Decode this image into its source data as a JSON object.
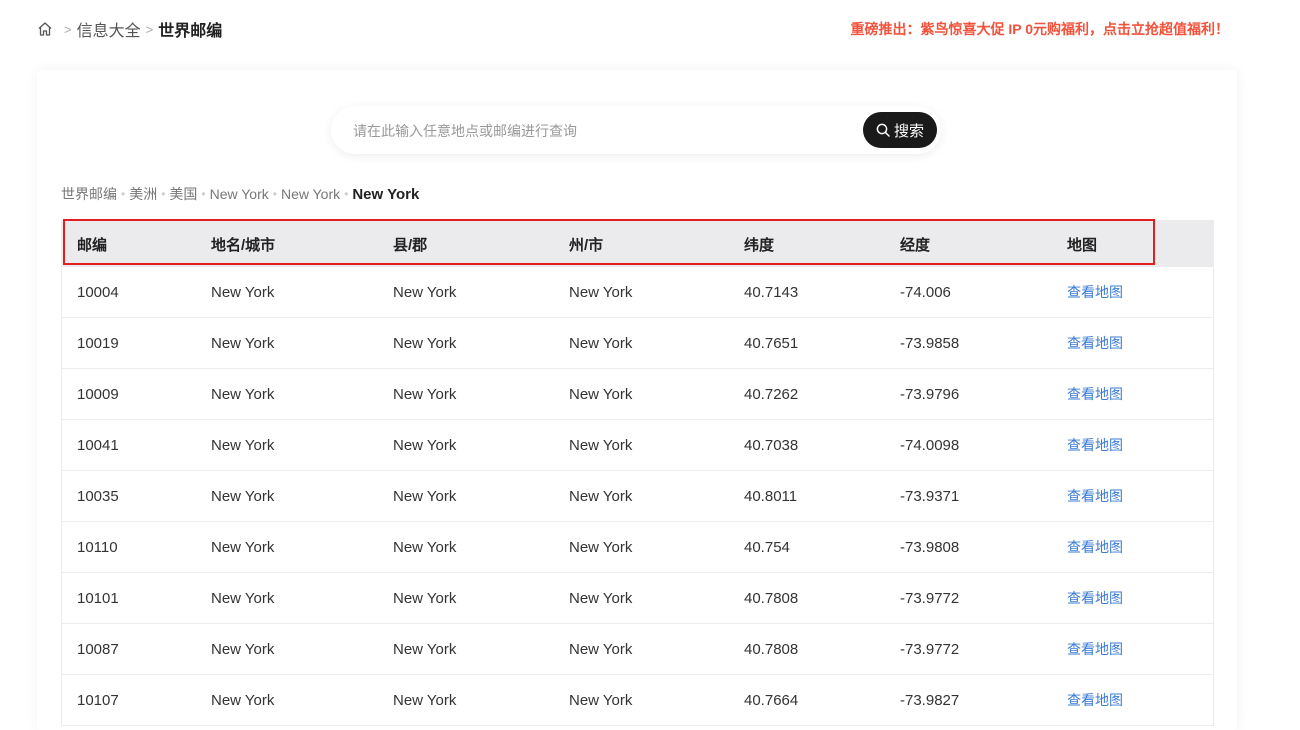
{
  "breadcrumb_top": {
    "items": [
      "信息大全",
      "世界邮编"
    ]
  },
  "promo": "重磅推出：紫鸟惊喜大促 IP 0元购福利，点击立抢超值福利！",
  "search": {
    "placeholder": "请在此输入任意地点或邮编进行查询",
    "button_label": "搜索"
  },
  "breadcrumb_main": {
    "items": [
      "世界邮编",
      "美洲",
      "美国",
      "New York",
      "New York"
    ],
    "current": "New York"
  },
  "table": {
    "headers": [
      "邮编",
      "地名/城市",
      "县/郡",
      "州/市",
      "纬度",
      "经度",
      "地图"
    ],
    "rows": [
      [
        "10004",
        "New York",
        "New York",
        "New York",
        "40.7143",
        "-74.006",
        "查看地图"
      ],
      [
        "10019",
        "New York",
        "New York",
        "New York",
        "40.7651",
        "-73.9858",
        "查看地图"
      ],
      [
        "10009",
        "New York",
        "New York",
        "New York",
        "40.7262",
        "-73.9796",
        "查看地图"
      ],
      [
        "10041",
        "New York",
        "New York",
        "New York",
        "40.7038",
        "-74.0098",
        "查看地图"
      ],
      [
        "10035",
        "New York",
        "New York",
        "New York",
        "40.8011",
        "-73.9371",
        "查看地图"
      ],
      [
        "10110",
        "New York",
        "New York",
        "New York",
        "40.754",
        "-73.9808",
        "查看地图"
      ],
      [
        "10101",
        "New York",
        "New York",
        "New York",
        "40.7808",
        "-73.9772",
        "查看地图"
      ],
      [
        "10087",
        "New York",
        "New York",
        "New York",
        "40.7808",
        "-73.9772",
        "查看地图"
      ],
      [
        "10107",
        "New York",
        "New York",
        "New York",
        "40.7664",
        "-73.9827",
        "查看地图"
      ]
    ]
  },
  "colors": {
    "promo": "#f2523b",
    "link": "#3a7bd5",
    "highlight_border": "#e02020",
    "header_bg": "#ebebee"
  }
}
